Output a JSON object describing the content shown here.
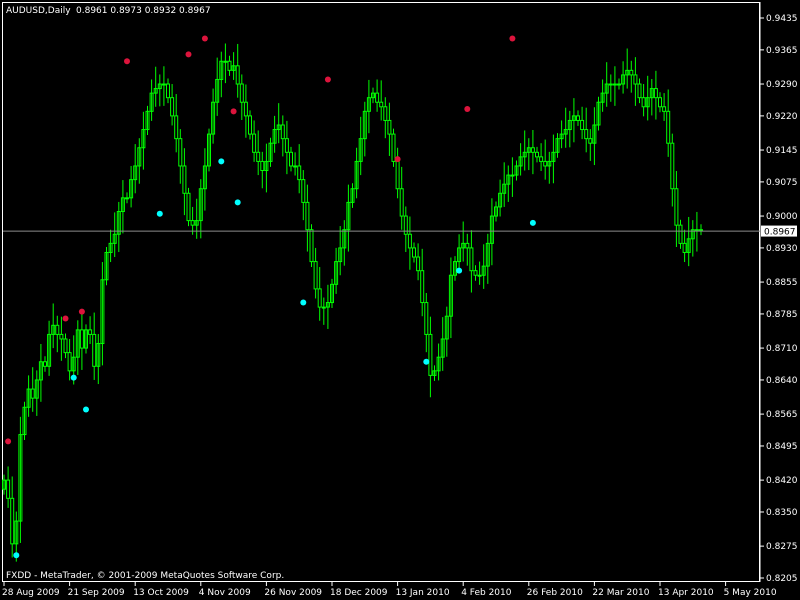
{
  "header": {
    "symbol": "AUDUSD,Daily",
    "ohlc": "0.8961 0.8973 0.8932 0.8967"
  },
  "footer": {
    "copyright": "FXDD - MetaTrader, © 2001-2009 MetaQuotes Software Corp."
  },
  "colors": {
    "background": "#000000",
    "frame": "#ffffff",
    "candle": "#00ff00",
    "fractal_up": "#dc143c",
    "fractal_down": "#00ffff",
    "price_line": "#8c8c8c",
    "price_tag_bg": "#ffffff",
    "price_tag_text": "#000000"
  },
  "chart_data": {
    "type": "candlestick",
    "instrument": "AUDUSD",
    "timeframe": "Daily",
    "y_ticks": [
      "0.9435",
      "0.9365",
      "0.9290",
      "0.9220",
      "0.9145",
      "0.9075",
      "0.9000",
      "0.8930",
      "0.8855",
      "0.8785",
      "0.8710",
      "0.8640",
      "0.8565",
      "0.8495",
      "0.8420",
      "0.8350",
      "0.8275",
      "0.8205"
    ],
    "ylim": [
      0.8205,
      0.9435
    ],
    "x_ticks": [
      "28 Aug 2009",
      "21 Sep 2009",
      "13 Oct 2009",
      "4 Nov 2009",
      "26 Nov 2009",
      "18 Dec 2009",
      "13 Jan 2010",
      "4 Feb 2010",
      "26 Feb 2010",
      "22 Mar 2010",
      "13 Apr 2010",
      "5 May 2010"
    ],
    "x_tick_index": [
      0,
      16,
      32,
      48,
      64,
      80,
      96,
      112,
      128,
      144,
      160,
      176
    ],
    "current_price": 0.8967,
    "current_price_label": "0.8967",
    "series": [
      {
        "name": "close",
        "values": [
          0.842,
          0.838,
          0.828,
          0.833,
          0.852,
          0.858,
          0.862,
          0.86,
          0.864,
          0.868,
          0.867,
          0.874,
          0.876,
          0.874,
          0.873,
          0.87,
          0.866,
          0.869,
          0.875,
          0.871,
          0.875,
          0.874,
          0.867,
          0.872,
          0.886,
          0.892,
          0.894,
          0.896,
          0.901,
          0.904,
          0.904,
          0.908,
          0.911,
          0.915,
          0.919,
          0.923,
          0.927,
          0.928,
          0.929,
          0.929,
          0.926,
          0.922,
          0.917,
          0.911,
          0.905,
          0.899,
          0.898,
          0.899,
          0.906,
          0.911,
          0.918,
          0.925,
          0.93,
          0.934,
          0.934,
          0.932,
          0.933,
          0.929,
          0.925,
          0.922,
          0.918,
          0.914,
          0.912,
          0.91,
          0.912,
          0.916,
          0.919,
          0.92,
          0.917,
          0.914,
          0.911,
          0.911,
          0.908,
          0.903,
          0.897,
          0.89,
          0.884,
          0.88,
          0.88,
          0.881,
          0.885,
          0.89,
          0.893,
          0.897,
          0.903,
          0.906,
          0.912,
          0.917,
          0.923,
          0.926,
          0.927,
          0.925,
          0.924,
          0.921,
          0.918,
          0.912,
          0.906,
          0.9,
          0.896,
          0.893,
          0.891,
          0.888,
          0.881,
          0.874,
          0.865,
          0.866,
          0.869,
          0.873,
          0.878,
          0.887,
          0.89,
          0.893,
          0.894,
          0.893,
          0.888,
          0.887,
          0.887,
          0.889,
          0.894,
          0.9,
          0.902,
          0.905,
          0.907,
          0.909,
          0.909,
          0.911,
          0.913,
          0.914,
          0.915,
          0.914,
          0.913,
          0.912,
          0.911,
          0.912,
          0.914,
          0.917,
          0.918,
          0.919,
          0.921,
          0.922,
          0.921,
          0.919,
          0.917,
          0.916,
          0.92,
          0.925,
          0.927,
          0.929,
          0.929,
          0.929,
          0.929,
          0.931,
          0.932,
          0.931,
          0.929,
          0.926,
          0.924,
          0.926,
          0.928,
          0.926,
          0.924,
          0.923,
          0.916,
          0.906,
          0.898,
          0.894,
          0.892,
          0.895,
          0.897,
          0.897,
          0.897
        ]
      },
      {
        "name": "fractal_up",
        "points": [
          [
            1,
            0.8505
          ],
          [
            15,
            0.8775
          ],
          [
            19,
            0.879
          ],
          [
            30,
            0.934
          ],
          [
            45,
            0.9355
          ],
          [
            49,
            0.939
          ],
          [
            56,
            0.923
          ],
          [
            79,
            0.93
          ],
          [
            96,
            0.9125
          ],
          [
            113,
            0.9235
          ],
          [
            124,
            0.939
          ]
        ]
      },
      {
        "name": "fractal_down",
        "points": [
          [
            3,
            0.8255
          ],
          [
            17,
            0.8645
          ],
          [
            20,
            0.8575
          ],
          [
            38,
            0.9005
          ],
          [
            53,
            0.912
          ],
          [
            57,
            0.903
          ],
          [
            73,
            0.881
          ],
          [
            103,
            0.868
          ],
          [
            111,
            0.888
          ],
          [
            129,
            0.8985
          ]
        ]
      }
    ]
  }
}
